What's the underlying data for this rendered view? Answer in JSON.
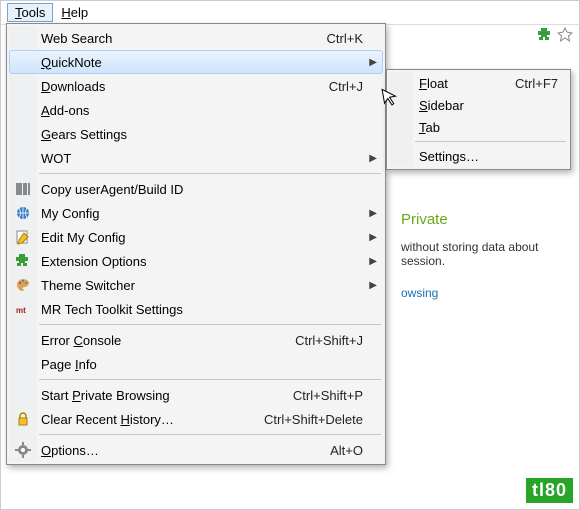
{
  "menubar": {
    "tools": "Tools",
    "help": "Help"
  },
  "menu": {
    "web_search": {
      "label": "Web Search",
      "shortcut": "Ctrl+K"
    },
    "quicknote": {
      "label": "QuickNote"
    },
    "downloads": {
      "label": "Downloads",
      "shortcut": "Ctrl+J"
    },
    "addons": {
      "label": "Add-ons"
    },
    "gears": {
      "label": "Gears Settings"
    },
    "wot": {
      "label": "WOT"
    },
    "copy_ua": {
      "label": "Copy userAgent/Build ID"
    },
    "my_config": {
      "label": "My Config"
    },
    "edit_my_config": {
      "label": "Edit My Config"
    },
    "ext_options": {
      "label": "Extension Options"
    },
    "theme_switcher": {
      "label": "Theme Switcher"
    },
    "mr_tech": {
      "label": "MR Tech Toolkit Settings"
    },
    "error_console": {
      "label": "Error Console",
      "shortcut": "Ctrl+Shift+J"
    },
    "page_info": {
      "label": "Page Info"
    },
    "start_private": {
      "label": "Start Private Browsing",
      "shortcut": "Ctrl+Shift+P"
    },
    "clear_history": {
      "label": "Clear Recent History…",
      "shortcut": "Ctrl+Shift+Delete"
    },
    "options": {
      "label": "Options…",
      "shortcut": "Alt+O"
    }
  },
  "submenu": {
    "float": {
      "label": "Float",
      "shortcut": "Ctrl+F7"
    },
    "sidebar": {
      "label": "Sidebar"
    },
    "tab": {
      "label": "Tab"
    },
    "settings": {
      "label": "Settings…"
    }
  },
  "background": {
    "heading": "Private",
    "line1": "without storing data about",
    "line2": "session.",
    "link": "owsing"
  },
  "watermark": "tl80"
}
